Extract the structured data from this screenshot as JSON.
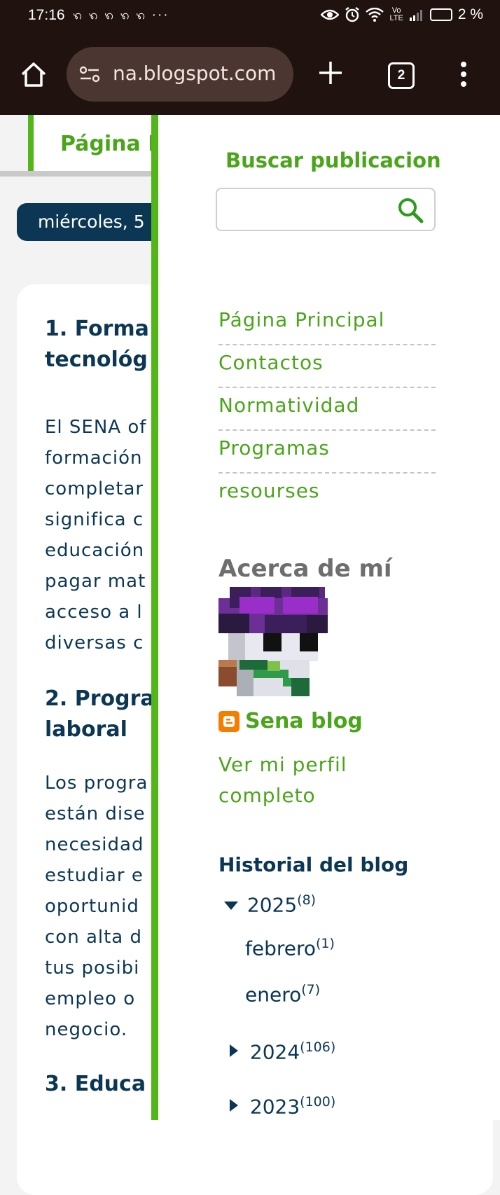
{
  "status_bar": {
    "time": "17:16",
    "notification_icons": "ꩫ ꩫ ꩫ ꩫ ꩫ ···",
    "network_label_top": "Vo",
    "network_label_bottom": "LTE",
    "battery": "2 %"
  },
  "browser": {
    "url": "na.blogspot.com",
    "tab_count": "2"
  },
  "page": {
    "nav_tab_label": "Página P",
    "date_label": "miércoles, 5",
    "article_lines": [
      {
        "kind": "h",
        "text": "1. Forma"
      },
      {
        "kind": "h",
        "text": "tecnológ"
      },
      {
        "kind": "p",
        "text": "El SENA of"
      },
      {
        "kind": "p",
        "text": "formación"
      },
      {
        "kind": "p",
        "text": "completar"
      },
      {
        "kind": "p",
        "text": "significa c"
      },
      {
        "kind": "p",
        "text": "educación"
      },
      {
        "kind": "p",
        "text": "pagar mat"
      },
      {
        "kind": "p",
        "text": "acceso a l"
      },
      {
        "kind": "p",
        "text": "diversas c"
      },
      {
        "kind": "h",
        "text": "2. Progra"
      },
      {
        "kind": "h",
        "text": "laboral"
      },
      {
        "kind": "p",
        "text": "Los progra"
      },
      {
        "kind": "p",
        "text": "están dise"
      },
      {
        "kind": "p",
        "text": "necesidad"
      },
      {
        "kind": "p",
        "text": "estudiar e"
      },
      {
        "kind": "p",
        "text": "oportunid"
      },
      {
        "kind": "p",
        "text": "con alta d"
      },
      {
        "kind": "p",
        "text": "tus posibi"
      },
      {
        "kind": "p",
        "text": "empleo o"
      },
      {
        "kind": "p",
        "text": "negocio."
      },
      {
        "kind": "h",
        "text": "3. Educa"
      }
    ]
  },
  "sidebar": {
    "search": {
      "title": "Buscar publicacion",
      "placeholder": ""
    },
    "pages": [
      "Página Principal",
      "Contactos",
      "Normatividad",
      "Programas",
      "resourses"
    ],
    "about": {
      "title": "Acerca de mí",
      "profile_name": "Sena blog",
      "profile_link": "Ver mi perfil completo"
    },
    "history": {
      "title": "Historial del blog",
      "items": [
        {
          "label": "2025",
          "count": "(8)",
          "expanded": true
        },
        {
          "label": "febrero",
          "count": "(1)"
        },
        {
          "label": "enero",
          "count": "(7)"
        },
        {
          "label": "2024",
          "count": "(106)",
          "expanded": false
        },
        {
          "label": "2023",
          "count": "(100)",
          "expanded": false
        }
      ]
    }
  },
  "colors": {
    "accent_green": "#52b51a",
    "link_green": "#4aa51b",
    "navy": "#0b3754",
    "toolbar_bg": "#20130f"
  }
}
